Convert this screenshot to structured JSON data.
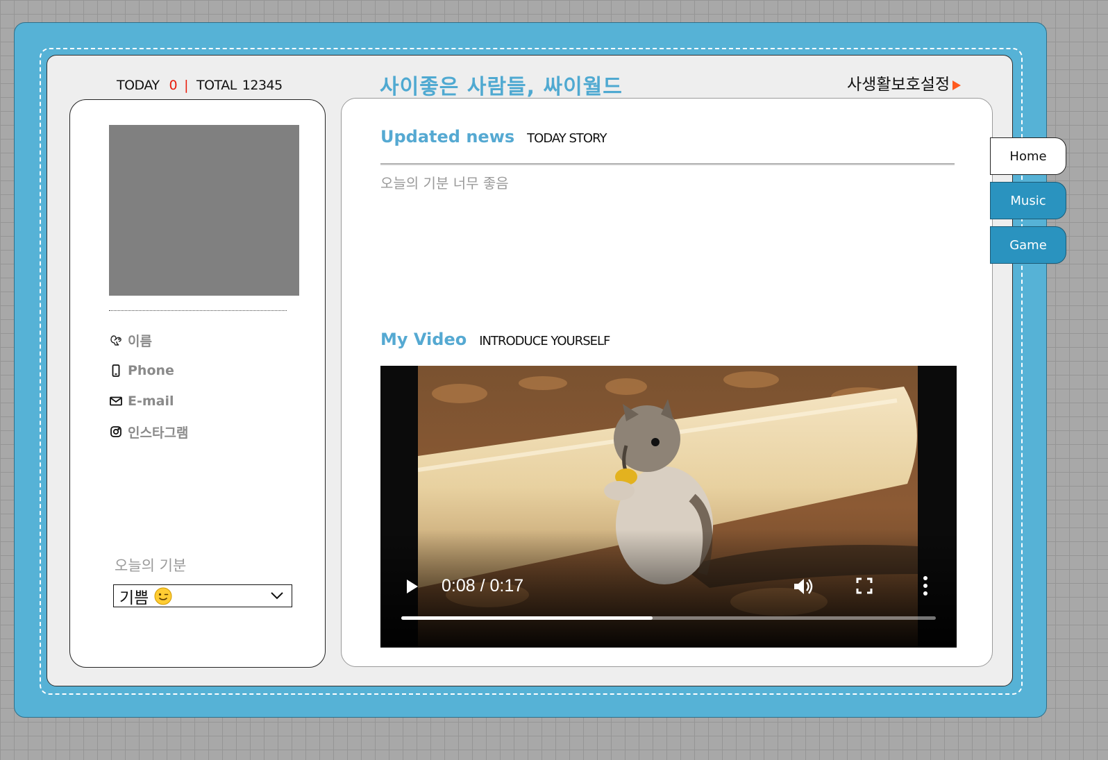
{
  "header": {
    "today_label": "TODAY",
    "today_count": "0",
    "separator": "|",
    "total_label": "TOTAL",
    "total_count": "12345",
    "site_title": "사이좋은 사람들, 싸이월드",
    "privacy_link": "사생활보호설정"
  },
  "profile": {
    "items": [
      {
        "icon": "squirrel-icon",
        "label": "이름"
      },
      {
        "icon": "phone-icon",
        "label": "Phone"
      },
      {
        "icon": "envelope-icon",
        "label": "E-mail"
      },
      {
        "icon": "instagram-icon",
        "label": "인스타그램"
      }
    ],
    "mood_label": "오늘의 기분",
    "mood_selected": "기쁨",
    "mood_emoji": "winking-face-icon"
  },
  "news": {
    "title": "Updated news",
    "subtitle": "TODAY STORY",
    "text": "오늘의 기분 너무 좋음"
  },
  "video": {
    "title": "My Video",
    "subtitle": "INTRODUCE YOURSELF",
    "current_time": "0:08",
    "duration": "0:17",
    "time_display": "0:08 / 0:17",
    "progress": 0.47
  },
  "tabs": [
    {
      "label": "Home",
      "active": true
    },
    {
      "label": "Music",
      "active": false
    },
    {
      "label": "Game",
      "active": false
    }
  ],
  "colors": {
    "frame": "#56b2d6",
    "accent_title": "#4fa9d1",
    "today_count": "#e81c0c",
    "tab_inactive": "#2a93bf",
    "privacy_arrow": "#ff5a1f"
  }
}
